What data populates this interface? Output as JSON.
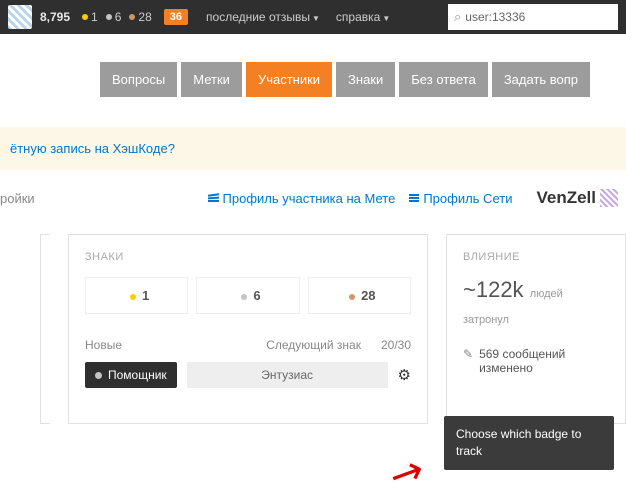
{
  "topbar": {
    "reputation": "8,795",
    "gold": "1",
    "silver": "6",
    "bronze": "28",
    "inbox": "36",
    "reviews": "последние отзывы",
    "help": "справка",
    "search": "user:13336"
  },
  "nav": {
    "questions": "Вопросы",
    "tags": "Метки",
    "users": "Участники",
    "badges": "Знаки",
    "unanswered": "Без ответа",
    "ask": "Задать вопр"
  },
  "banner": {
    "text": "ётную запись на ХэшКоде?"
  },
  "profile": {
    "settings": "ройки",
    "meta": "Профиль участника на Мете",
    "network": "Профиль Сети",
    "username": "VenZell"
  },
  "badges_panel": {
    "title": "ЗНАКИ",
    "gold": "1",
    "silver": "6",
    "bronze": "28",
    "new_label": "Новые",
    "next_label": "Следующий знак",
    "progress": "20/30",
    "new_badge": "Помощник",
    "next_badge": "Энтузиас"
  },
  "impact": {
    "title": "ВЛИЯНИЕ",
    "reach": "~122k",
    "reach_label": "людей затронул",
    "edits_count": "569",
    "edits_label": "сообщений изменено"
  },
  "tooltip": "Choose which badge to track"
}
